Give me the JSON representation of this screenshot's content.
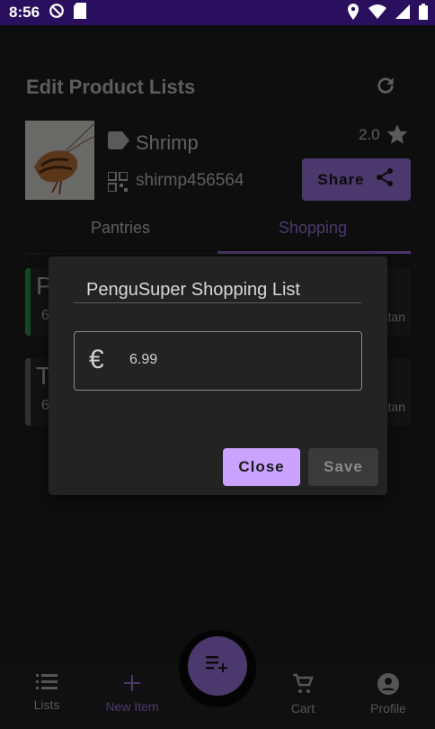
{
  "status_bar": {
    "time": "8:56"
  },
  "header": {
    "title": "Edit Product Lists"
  },
  "product": {
    "name": "Shrimp",
    "code": "shirmp456564",
    "rating": "2.0",
    "share_label": "Share"
  },
  "tabs": [
    {
      "label": "Pantries"
    },
    {
      "label": "Shopping"
    }
  ],
  "cards": [
    {
      "initial": "P",
      "sub": "6",
      "right": "tan",
      "accent": "#2e9e4f"
    },
    {
      "initial": "T",
      "sub": "6",
      "right": "tan",
      "accent": "#6b6b6b"
    }
  ],
  "dialog": {
    "title": "PenguSuper Shopping List",
    "price_value": "6.99",
    "currency_symbol": "€",
    "close_label": "Close",
    "save_label": "Save"
  },
  "bottom_nav": [
    {
      "label": "Lists",
      "icon": "list-icon"
    },
    {
      "label": "New Item",
      "icon": "plus-icon"
    },
    {
      "label": "Cart",
      "icon": "cart-icon"
    },
    {
      "label": "Profile",
      "icon": "account-icon"
    }
  ],
  "colors": {
    "accent": "#a77df0",
    "status_bar": "#2a0f5e"
  }
}
